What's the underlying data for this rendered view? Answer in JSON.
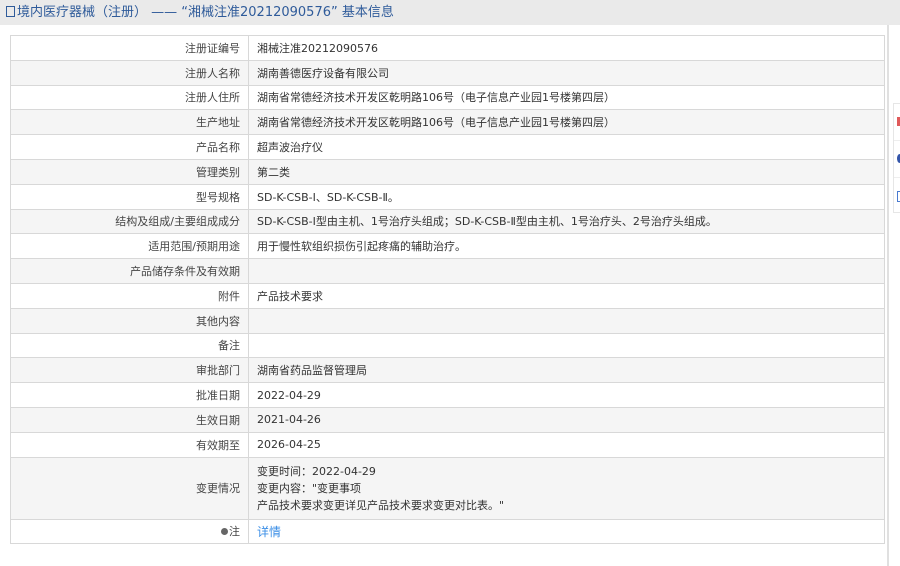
{
  "header": {
    "title": "境内医疗器械（注册） —— “湘械注准20212090576” 基本信息"
  },
  "rows": [
    {
      "label": "注册证编号",
      "value": "湘械注准20212090576"
    },
    {
      "label": "注册人名称",
      "value": "湖南善德医疗设备有限公司"
    },
    {
      "label": "注册人住所",
      "value": "湖南省常德经济技术开发区乾明路106号（电子信息产业园1号楼第四层）"
    },
    {
      "label": "生产地址",
      "value": "湖南省常德经济技术开发区乾明路106号（电子信息产业园1号楼第四层）"
    },
    {
      "label": "产品名称",
      "value": "超声波治疗仪"
    },
    {
      "label": "管理类别",
      "value": "第二类"
    },
    {
      "label": "型号规格",
      "value": "SD-K-CSB-Ⅰ、SD-K-CSB-Ⅱ。"
    },
    {
      "label": "结构及组成/主要组成成分",
      "value": "SD-K-CSB-Ⅰ型由主机、1号治疗头组成；SD-K-CSB-Ⅱ型由主机、1号治疗头、2号治疗头组成。"
    },
    {
      "label": "适用范围/预期用途",
      "value": "用于慢性软组织损伤引起疼痛的辅助治疗。"
    },
    {
      "label": "产品储存条件及有效期",
      "value": ""
    },
    {
      "label": "附件",
      "value": "产品技术要求"
    },
    {
      "label": "其他内容",
      "value": ""
    },
    {
      "label": "备注",
      "value": ""
    },
    {
      "label": "审批部门",
      "value": "湖南省药品监督管理局"
    },
    {
      "label": "批准日期",
      "value": "2022-04-29"
    },
    {
      "label": "生效日期",
      "value": "2021-04-26"
    },
    {
      "label": "有效期至",
      "value": "2026-04-25"
    }
  ],
  "changes": {
    "label": "变更情况",
    "line1": "变更时间：2022-04-29",
    "line2": "变更内容：\"变更事项",
    "line3": "产品技术要求变更详见产品技术要求变更对比表。\""
  },
  "note": {
    "label": "注",
    "link": "详情"
  }
}
